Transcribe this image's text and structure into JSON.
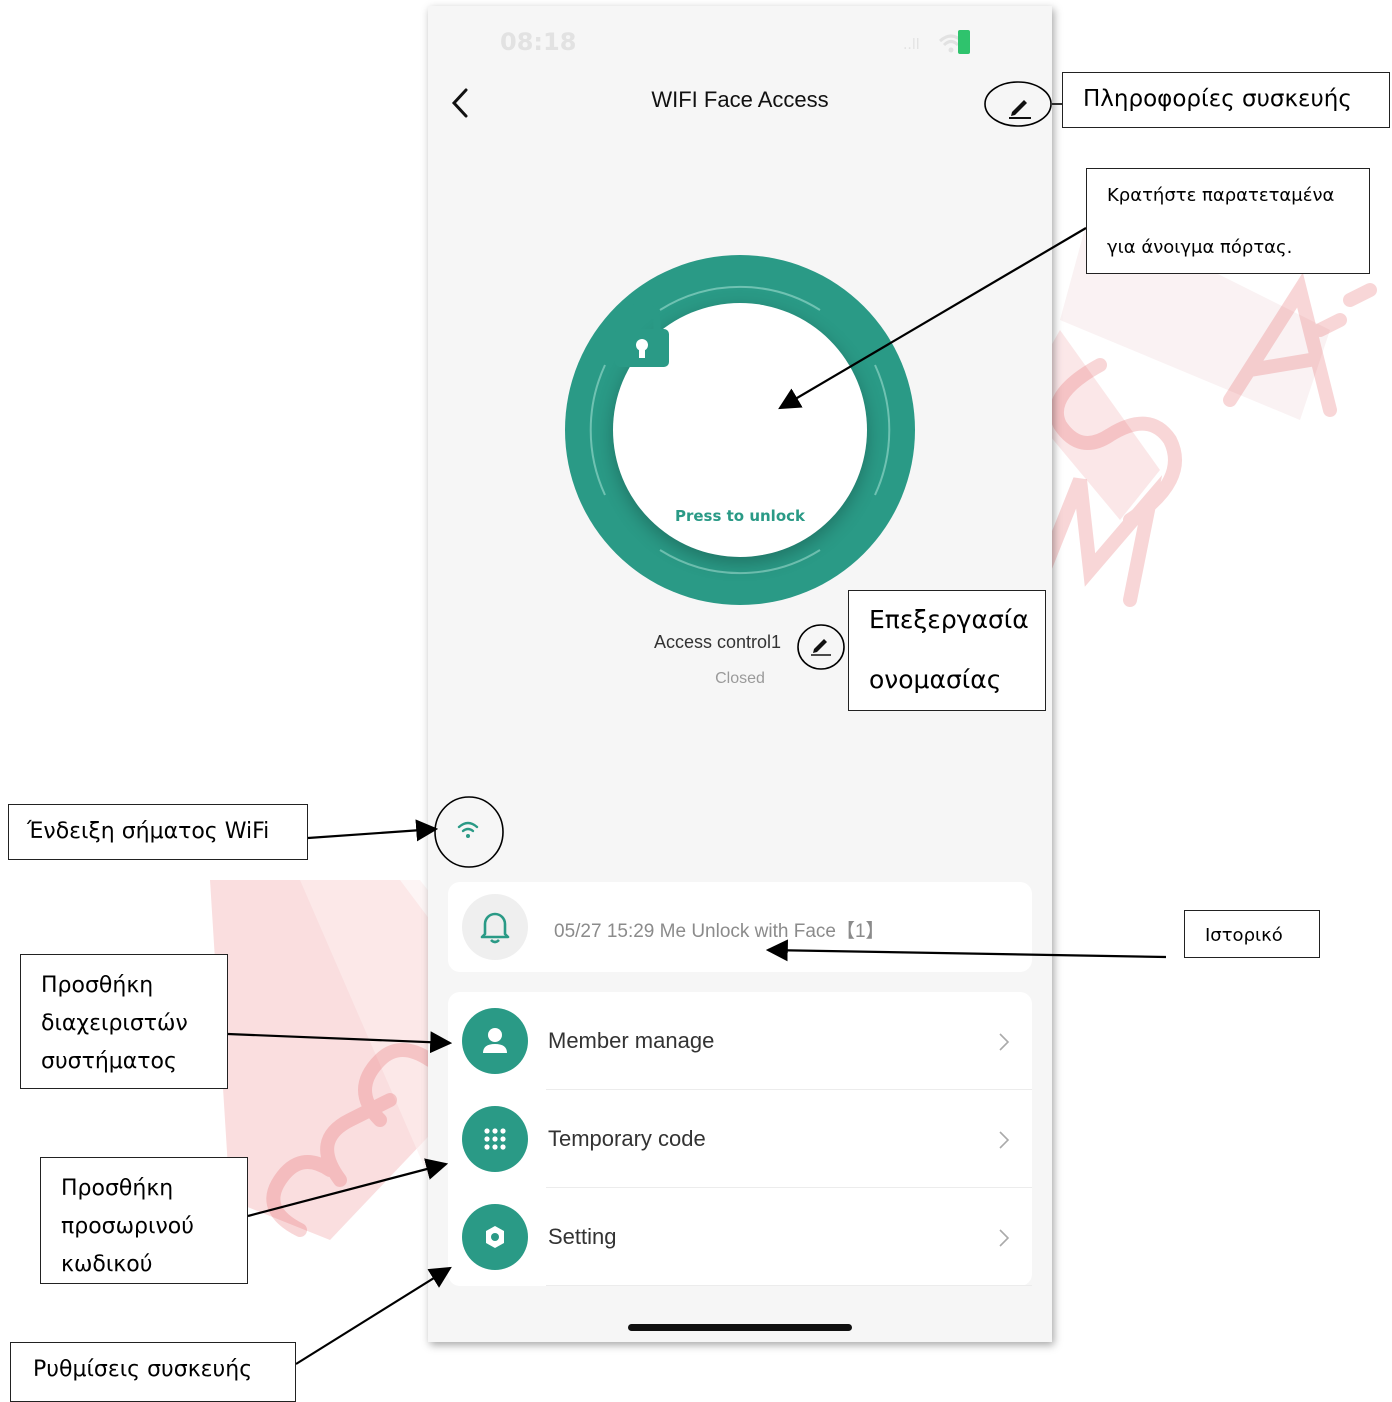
{
  "status_bar": {
    "time": "08:18",
    "signal": "..ll"
  },
  "header": {
    "title": "WIFI Face Access"
  },
  "unlock": {
    "label": "Press to unlock"
  },
  "device": {
    "name": "Access control1",
    "status": "Closed"
  },
  "history": {
    "entry": "05/27 15:29 Me  Unlock with Face【1】"
  },
  "menu": {
    "items": [
      {
        "label": "Member manage",
        "icon": "person-icon"
      },
      {
        "label": "Temporary code",
        "icon": "keypad-icon"
      },
      {
        "label": "Setting",
        "icon": "gear-icon"
      }
    ]
  },
  "colors": {
    "accent": "#2a9a86",
    "background": "#f6f6f6",
    "watermark": "#e0464b"
  },
  "annotations": {
    "device_info": "Πληροφορίες συσκευής",
    "hold_unlock_1": "Κρατήστε παρατεταμένα",
    "hold_unlock_2": "για άνοιγμα πόρτας.",
    "edit_name_1": "Επεξεργασία",
    "edit_name_2": "ονομασίας",
    "wifi_signal": "Ένδειξη σήματος WiFi",
    "history": "Ιστορικό",
    "add_admins": "Προσθήκη διαχειριστών συστήματος",
    "add_temp_code": "Προσθήκη προσωρινού κωδικού",
    "device_settings": "Ρυθμίσεις συσκευής"
  }
}
